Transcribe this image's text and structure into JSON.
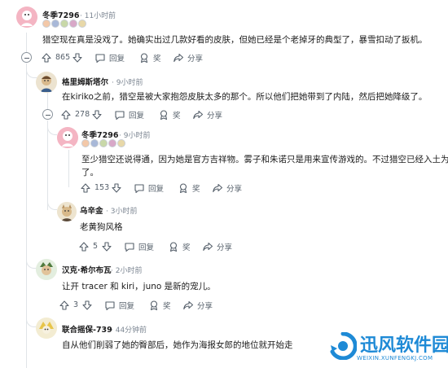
{
  "comments": [
    {
      "username": "冬季7296",
      "time": "· 11小时前",
      "text": "猎空现在真是没戏了。她确实出过几款好看的皮肤，但她已经是个老掉牙的典型了，暴雪扣动了扳机。",
      "votes": "865",
      "reply_label": "回复",
      "award_label": "奖",
      "share_label": "分享",
      "avatar_color": "#f1a6b5"
    },
    {
      "username": "格里姆斯塔尔",
      "time": "· 9小时前",
      "text": "在kiriko之前，猎空是被大家抱怨皮肤太多的那个。所以他们把她带到了内陆，然后把她降级了。",
      "votes": "278",
      "reply_label": "回复",
      "award_label": "奖",
      "share_label": "分享",
      "avatar_color": "#e6dcc8"
    },
    {
      "username": "冬季7296",
      "time": "· 9小时前",
      "text_line1": "至少猎空还说得通，因为她是官方吉祥物。雾子和朱诺只是用来宣传游戏的。不过猎空已经入土为安",
      "text_line2": "了。",
      "votes": "153",
      "reply_label": "回复",
      "award_label": "奖",
      "share_label": "分享",
      "avatar_color": "#f1a6b5"
    },
    {
      "username": "乌辛金",
      "time": "· 3小时前",
      "text": "老黄狗风格",
      "votes": "5",
      "reply_label": "回复",
      "award_label": "奖",
      "share_label": "分享",
      "avatar_color": "#e8e0cc"
    },
    {
      "username": "汉克·希尔布瓦",
      "time": "· 2小时前",
      "text": "让开 tracer 和 kiri，juno 是新的宠儿。",
      "votes": "3",
      "reply_label": "回复",
      "award_label": "奖",
      "share_label": "分享",
      "avatar_color": "#d9e8d4"
    },
    {
      "username": "联合摇保-739",
      "time": "· 44分钟前",
      "text": "自从他们削弱了她的臀部后，她作为海报女郎的地位就开始走",
      "avatar_color": "#efe6c4"
    }
  ],
  "watermark": {
    "title": "迅风软件园",
    "url": "WEIXIN.XUNFENGKJ.COM",
    "color": "#1e8ad6"
  }
}
